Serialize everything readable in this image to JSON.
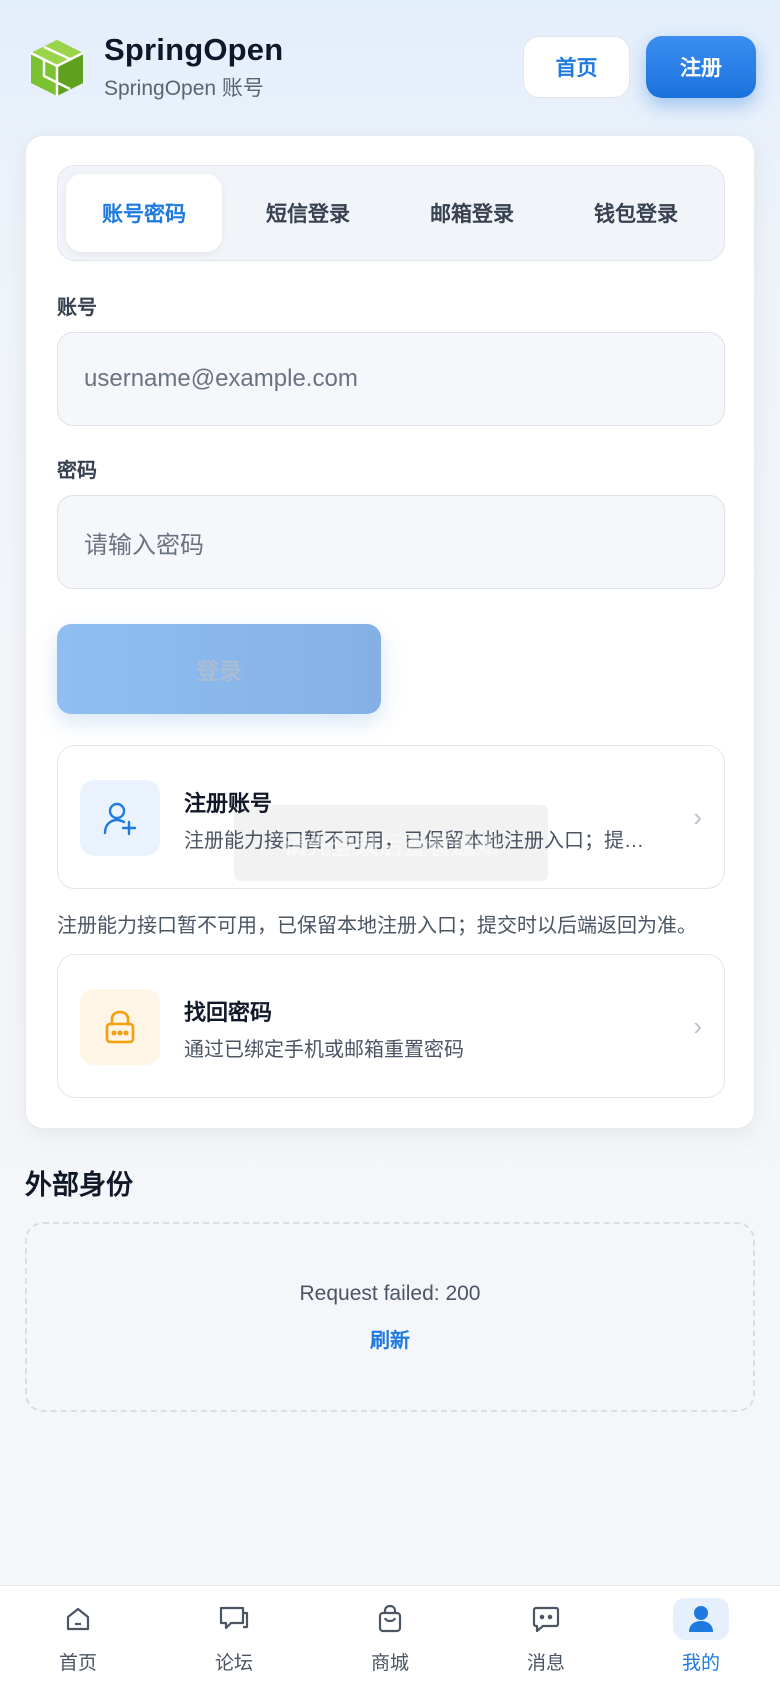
{
  "header": {
    "brand_name": "SpringOpen",
    "brand_sub": "SpringOpen 账号",
    "home_label": "首页",
    "register_label": "注册"
  },
  "tabs": [
    {
      "label": "账号密码",
      "active": true
    },
    {
      "label": "短信登录",
      "active": false
    },
    {
      "label": "邮箱登录",
      "active": false
    },
    {
      "label": "钱包登录",
      "active": false
    }
  ],
  "form": {
    "account_label": "账号",
    "account_placeholder": "username@example.com",
    "password_label": "密码",
    "password_placeholder": "请输入密码",
    "login_label": "登录"
  },
  "actions": [
    {
      "title": "注册账号",
      "desc": "注册能力接口暂不可用，已保留本地注册入口；提交时以后端返回为准。",
      "icon": "user-plus-icon"
    },
    {
      "title": "找回密码",
      "desc": "通过已绑定手机或邮箱重置密码",
      "icon": "lock-icon"
    }
  ],
  "register_note": "注册能力接口暂不可用，已保留本地注册入口；提交时以后端返回为准。",
  "toast": "请先登录后查看通知",
  "external": {
    "title": "外部身份",
    "error": "Request failed: 200",
    "refresh_label": "刷新"
  },
  "bottom_nav": [
    {
      "label": "首页",
      "icon": "home-icon",
      "active": false
    },
    {
      "label": "论坛",
      "icon": "forum-icon",
      "active": false
    },
    {
      "label": "商城",
      "icon": "shop-bag-icon",
      "active": false
    },
    {
      "label": "消息",
      "icon": "message-icon",
      "active": false
    },
    {
      "label": "我的",
      "icon": "user-icon",
      "active": true
    }
  ],
  "colors": {
    "accent": "#1f7ae0",
    "logo_green": "#7bc230",
    "warning_orange": "#f59e0b"
  }
}
